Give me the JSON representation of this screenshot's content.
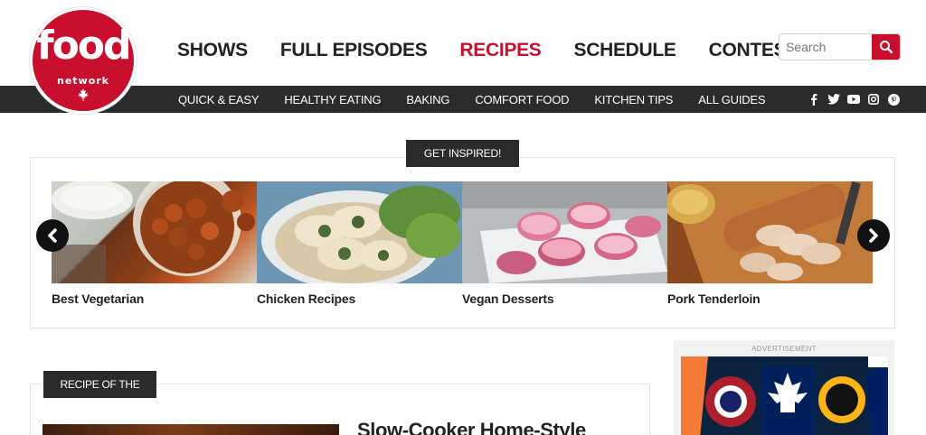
{
  "logo": {
    "word": "food",
    "sub": "network"
  },
  "main_nav": [
    {
      "label": "SHOWS",
      "active": false
    },
    {
      "label": "FULL EPISODES",
      "active": false
    },
    {
      "label": "RECIPES",
      "active": true
    },
    {
      "label": "SCHEDULE",
      "active": false
    },
    {
      "label": "CONTESTS",
      "active": false
    }
  ],
  "search": {
    "placeholder": "Search"
  },
  "sub_nav": [
    "QUICK & EASY",
    "HEALTHY EATING",
    "BAKING",
    "COMFORT FOOD",
    "KITCHEN TIPS",
    "ALL GUIDES"
  ],
  "social": [
    "facebook-icon",
    "twitter-icon",
    "youtube-icon",
    "instagram-icon",
    "pinterest-icon"
  ],
  "inspired": {
    "label": "GET INSPIRED!",
    "tiles": [
      {
        "caption": "Best Vegetarian"
      },
      {
        "caption": "Chicken Recipes"
      },
      {
        "caption": "Vegan Desserts"
      },
      {
        "caption": "Pork Tenderloin"
      }
    ]
  },
  "rotw": {
    "label": "RECIPE OF THE WEEK",
    "title": "Slow-Cooker Home-Style"
  },
  "ad": {
    "label": "ADVERTISEMENT"
  },
  "colors": {
    "brand": "#c8102e",
    "dark": "#2b2b2b"
  }
}
